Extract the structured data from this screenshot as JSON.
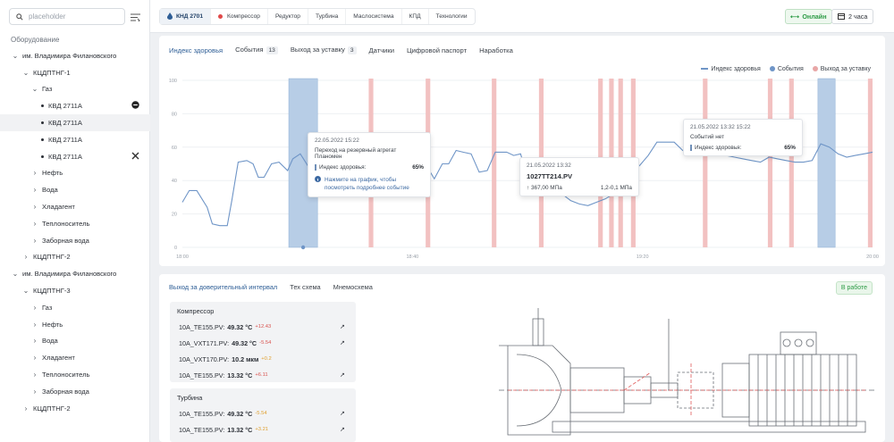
{
  "sidebar": {
    "search_placeholder": "placeholder",
    "tree_title": "Оборудование",
    "nodes": [
      {
        "label": "им. Владимира Филановского"
      },
      {
        "label": "КЦДПТНГ-1"
      },
      {
        "label": "Газ"
      },
      {
        "label": "КВД 2711А"
      },
      {
        "label": "КВД 2711А"
      },
      {
        "label": "КВД 2711А"
      },
      {
        "label": "КВД 2711А"
      },
      {
        "label": "Нефть"
      },
      {
        "label": "Вода"
      },
      {
        "label": "Хладагент"
      },
      {
        "label": "Теплоноситель"
      },
      {
        "label": "Заборная вода"
      },
      {
        "label": "КЦДПТНГ-2"
      },
      {
        "label": "им. Владимира Филановского"
      },
      {
        "label": "КЦДПТНГ-3"
      },
      {
        "label": "Газ"
      },
      {
        "label": "Нефть"
      },
      {
        "label": "Вода"
      },
      {
        "label": "Хладагент"
      },
      {
        "label": "Теплоноситель"
      },
      {
        "label": "Заборная вода"
      },
      {
        "label": "КЦДПТНГ-2"
      }
    ]
  },
  "topbar": {
    "tabs": [
      "КНД 2701",
      "Компрессор",
      "Редуктор",
      "Турбина",
      "Маслосистема",
      "КПД",
      "Технологии"
    ],
    "online_label": "Онлайн",
    "period_label": "2 часа"
  },
  "chart_tabs": {
    "health": "Индекс здоровья",
    "events": "События",
    "events_count": "13",
    "out_of_range": "Выход за уставку",
    "out_count": "3",
    "sensors": "Датчики",
    "passport": "Цифровой паспорт",
    "runtime": "Наработка"
  },
  "legend": {
    "health": "Индекс здоровья",
    "events": "События",
    "out": "Выход за уставку"
  },
  "colors": {
    "line": "#6f95c7",
    "event_band": "#b7cde6",
    "event_band_edge": "#8fb0d6",
    "out_band": "#f2c1c1",
    "accent": "#2e5e96",
    "online": "#2d9b46"
  },
  "chart_data": {
    "type": "line",
    "x_ticks": [
      "18:00",
      "18:40",
      "19:20",
      "20:00"
    ],
    "y_ticks": [
      "0",
      "20",
      "40",
      "60",
      "80",
      "100"
    ],
    "ylim": [
      0,
      100
    ],
    "x_range_min": [
      0,
      120
    ],
    "series": [
      {
        "name": "Индекс здоровья",
        "x": [
          0,
          1.2,
          2.5,
          4.3,
          5.2,
          6.5,
          7.8,
          8.6,
          9.7,
          11.2,
          12.3,
          13.2,
          14.2,
          15.5,
          16.8,
          18.3,
          19.2,
          20.5,
          21.8,
          23.2,
          24.6,
          25.8,
          27.0,
          28.3,
          29.4,
          30.6,
          31.8,
          32.9,
          34.1,
          35.3,
          36.5,
          37.5,
          38.6,
          40.0,
          41.2,
          42.6,
          43.8,
          45.2,
          46.3,
          47.6,
          48.8,
          50.2,
          51.6,
          53.0,
          54.4,
          55.4,
          56.4,
          57.6,
          58.8,
          60.2,
          61.6,
          63.0,
          64.5,
          66.0,
          67.5,
          69.0,
          70.5,
          72.0,
          73.5,
          75.0,
          76.5,
          78.0,
          79.5,
          81.0,
          82.5,
          84.0,
          85.5,
          87.0,
          88.5,
          90.0,
          91.5,
          93.0,
          94.5,
          96.0,
          97.5,
          99.0,
          100.5,
          102.0,
          103.5,
          105.0,
          106.5,
          108.0,
          109.5,
          111.0,
          112.5,
          114.0,
          115.5,
          117.0,
          118.5,
          120.0
        ],
        "y": [
          27,
          34,
          34,
          24,
          14,
          13,
          13,
          28,
          51,
          52,
          50,
          42,
          42,
          50,
          51,
          46,
          53,
          56,
          49,
          47,
          50,
          48,
          52,
          50,
          44,
          50,
          48,
          45,
          47,
          48,
          46,
          44,
          54,
          54,
          47,
          48,
          41,
          50,
          50,
          58,
          57,
          56,
          45,
          46,
          57,
          57,
          57,
          55,
          56,
          40,
          38,
          35,
          34,
          32,
          28,
          26,
          25,
          27,
          29,
          32,
          37,
          45,
          49,
          55,
          63,
          63,
          63,
          58,
          56,
          55,
          55,
          55,
          55,
          54,
          53,
          52,
          51,
          54,
          53,
          52,
          51,
          51,
          52,
          62,
          60,
          56,
          54,
          55,
          56,
          57
        ]
      }
    ],
    "event_bands": [
      [
        18.5,
        23.5
      ],
      [
        110.5,
        113.5
      ]
    ],
    "out_bands": [
      [
        32.4,
        33.2
      ],
      [
        42.3,
        43.1
      ],
      [
        53.8,
        54.6
      ],
      [
        62.0,
        62.8
      ],
      [
        72.3,
        73.1
      ],
      [
        74.2,
        75.0
      ],
      [
        75.8,
        76.6
      ],
      [
        78.0,
        78.8
      ],
      [
        90.5,
        91.3
      ],
      [
        101.8,
        102.6
      ],
      [
        105.5,
        106.3
      ],
      [
        119.2,
        120.0
      ]
    ],
    "event_markers": [
      {
        "x": 21.0,
        "y": 0
      }
    ]
  },
  "tooltips": {
    "t1": {
      "date": "22.05.2022 15:22",
      "text1": "Переход на резервный агрегат",
      "text2": "Планомен",
      "label": "Индекс здоровья:",
      "value": "65%",
      "hint1": "Нажмите на график, чтобы",
      "hint2": "посмотреть подробнее событие"
    },
    "t2": {
      "date": "21.05.2022 13:32",
      "tag": "1027TT214.PV",
      "value": "367,00 МПа",
      "range": "1,2-0,1 МПа"
    },
    "t3": {
      "date": "21.05.2022 13:32 15:22",
      "note": "Событий нет",
      "label": "Индекс здоровья:",
      "value": "65%"
    }
  },
  "bottom": {
    "tabs": [
      "Выход за доверительный интервал",
      "Тех схема",
      "Мнемосхема"
    ],
    "status": "В работе",
    "groups": [
      {
        "title": "Компрессор",
        "rows": [
          {
            "name": "10A_TE155.PV:",
            "value": "49.32 °C",
            "delta": "+12.43",
            "delta_color": "#d9534f"
          },
          {
            "name": "10A_VXT171.PV:",
            "value": "49.32 °C",
            "delta": "-5.54",
            "delta_color": "#d9534f"
          },
          {
            "name": "10A_VXT170.PV:",
            "value": "10.2 мкм",
            "delta": "+0.2",
            "delta_color": "#e0a030"
          },
          {
            "name": "10A_TE155.PV:",
            "value": "13.32 °C",
            "delta": "+6.11",
            "delta_color": "#d9534f"
          }
        ]
      },
      {
        "title": "Турбина",
        "rows": [
          {
            "name": "10A_TE155.PV:",
            "value": "49.32 °C",
            "delta": "-5.54",
            "delta_color": "#e0a030"
          },
          {
            "name": "10A_TE155.PV:",
            "value": "13.32 °C",
            "delta": "+3.21",
            "delta_color": "#e0a030"
          }
        ]
      }
    ]
  }
}
